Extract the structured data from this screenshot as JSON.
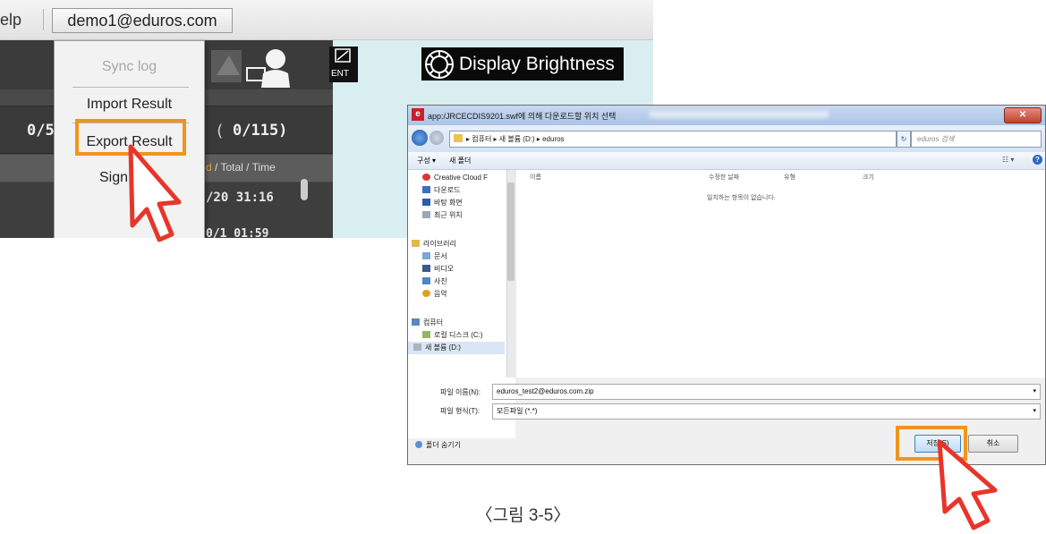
{
  "app": {
    "menu_help": "elp",
    "user": "demo1@eduros.com",
    "display_brightness": "Display Brightness",
    "event_label": "ENT",
    "counts": {
      "a": "0/5",
      "paren": "(",
      "b": "0/115)"
    },
    "table_header": {
      "highlight": "d",
      "rest": " / Total / Time"
    },
    "rows": [
      "/20  31:16",
      "0/1  01:59"
    ],
    "dropdown": {
      "items": [
        "Sync log",
        "Import Result",
        "Export Result",
        "Sign"
      ]
    }
  },
  "dialog": {
    "title": "app:/JRCECDIS9201.swf에 의해 다운로드할 위치 선택",
    "path": "▸ 컴퓨터 ▸ 새 볼륨 (D:) ▸ eduros",
    "search_placeholder": "eduros 검색",
    "toolbar": {
      "organize": "구성 ▾",
      "new_folder": "새 폴더"
    },
    "nav_items": [
      "Creative Cloud F",
      "다운로드",
      "바탕 화면",
      "최근 위치",
      "라이브러리",
      "문서",
      "비디오",
      "사진",
      "음악",
      "컴퓨터",
      "로컬 디스크 (C:)",
      "새 볼륨 (D:)"
    ],
    "columns": [
      "이름",
      "수정한 날짜",
      "유형",
      "크기"
    ],
    "empty_message": "일치하는 항목이 없습니다.",
    "filename_label": "파일 이름(N):",
    "filename_value": "eduros_test2@eduros.com.zip",
    "filetype_label": "파일 형식(T):",
    "filetype_value": "모든파일 (*.*)",
    "hide_folders": "폴더 숨기기",
    "save_label": "저장(S)",
    "cancel_label": "취소"
  },
  "caption": "〈그림 3-5〉",
  "colors": {
    "highlight": "#f0941e",
    "cursor": "#e8352a"
  }
}
